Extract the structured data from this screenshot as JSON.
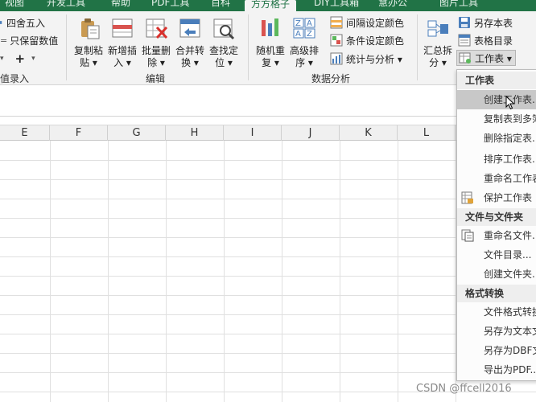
{
  "tabs": [
    {
      "label": "视图"
    },
    {
      "label": "开发工具"
    },
    {
      "label": "帮助"
    },
    {
      "label": "PDF工具"
    },
    {
      "label": "百科"
    },
    {
      "label": "方方格子"
    },
    {
      "label": "DIY工具箱"
    },
    {
      "label": "慧办公"
    },
    {
      "label": "图片工具"
    }
  ],
  "ribbon": {
    "left_partial": {
      "round_label": "四舍五入",
      "keep_value_label": "只保留数值",
      "plus_label": "+",
      "group_label": "值录入"
    },
    "edit_group": {
      "label": "编辑",
      "buttons": [
        {
          "l1": "复制粘",
          "l2": "贴 ▾"
        },
        {
          "l1": "新增插",
          "l2": "入 ▾"
        },
        {
          "l1": "批量删",
          "l2": "除 ▾"
        },
        {
          "l1": "合并转",
          "l2": "换 ▾"
        },
        {
          "l1": "查找定",
          "l2": "位 ▾"
        }
      ]
    },
    "analysis_group": {
      "label": "数据分析",
      "buttons": [
        {
          "l1": "随机重",
          "l2": "复 ▾"
        },
        {
          "l1": "高级排",
          "l2": "序 ▾"
        }
      ],
      "small": [
        {
          "label": "间隔设定颜色"
        },
        {
          "label": "条件设定颜色"
        },
        {
          "label": "统计与分析 ▾"
        }
      ]
    },
    "summary_group": {
      "button": {
        "l1": "汇总拆",
        "l2": "分 ▾"
      },
      "small": [
        {
          "label": "另存本表"
        },
        {
          "label": "表格目录"
        },
        {
          "label": "工作表 ▾"
        }
      ]
    }
  },
  "sheet": {
    "columns": [
      "E",
      "F",
      "G",
      "H",
      "I",
      "J",
      "K",
      "L"
    ]
  },
  "menu": {
    "sections": [
      {
        "header": "工作表",
        "items": [
          {
            "label": "创建工作表...",
            "highlighted": true
          },
          {
            "label": "复制表到多簿..."
          },
          {
            "label": "删除指定表..."
          },
          {
            "label": "排序工作表..."
          },
          {
            "label": "重命名工作表..."
          },
          {
            "label": "保护工作表",
            "icon": "protect-sheet-icon"
          }
        ]
      },
      {
        "header": "文件与文件夹",
        "items": [
          {
            "label": "重命名文件...",
            "icon": "rename-file-icon"
          },
          {
            "label": "文件目录..."
          },
          {
            "label": "创建文件夹..."
          }
        ]
      },
      {
        "header": "格式转换",
        "items": [
          {
            "label": "文件格式转换..."
          },
          {
            "label": "另存为文本文件..."
          },
          {
            "label": "另存为DBF文件..."
          },
          {
            "label": "导出为PDF..."
          }
        ]
      }
    ]
  },
  "watermark": "CSDN @ffcell2016",
  "colors": {
    "tab_green": "#217346",
    "ribbon_bg": "#f3f3f3",
    "menu_highlight": "#c8c8c8"
  }
}
